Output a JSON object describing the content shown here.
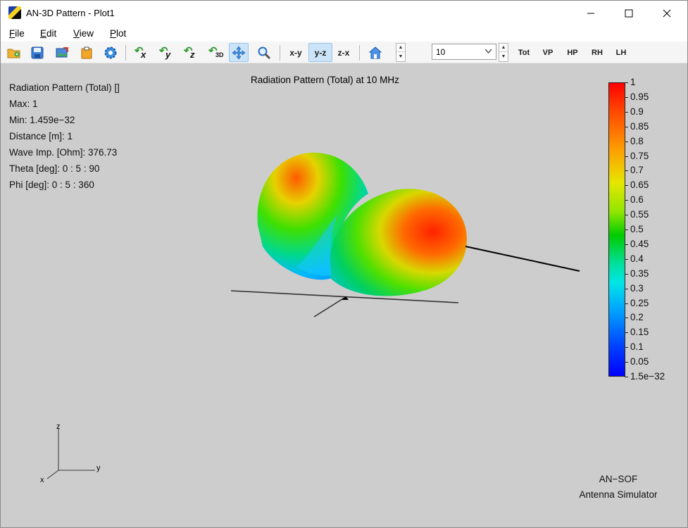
{
  "window": {
    "title": "AN-3D Pattern - Plot1"
  },
  "menu": [
    {
      "label": "File",
      "underline": "F",
      "rest": "ile"
    },
    {
      "label": "Edit",
      "underline": "E",
      "rest": "dit"
    },
    {
      "label": "View",
      "underline": "V",
      "rest": "iew"
    },
    {
      "label": "Plot",
      "underline": "P",
      "rest": "lot"
    }
  ],
  "toolbar": {
    "view_xy": "x-y",
    "view_yz": "y-z",
    "view_zx": "z-x",
    "rot_x": "x",
    "rot_y": "y",
    "rot_z": "z",
    "rot_3d": "3D",
    "combo_value": "10",
    "pol_tot": "Tot",
    "pol_vp": "VP",
    "pol_hp": "HP",
    "pol_rh": "RH",
    "pol_lh": "LH",
    "active_view": "y-z",
    "active_tool": "pan"
  },
  "info": {
    "line1": "Radiation Pattern (Total) []",
    "line2": "Max: 1",
    "line3": "Min: 1.459e−32",
    "line4": "Distance [m]: 1",
    "line5": "Wave Imp. [Ohm]: 376.73",
    "line6": "Theta [deg]: 0 : 5 : 90",
    "line7": "Phi [deg]: 0 : 5 : 360"
  },
  "plot": {
    "title": "Radiation Pattern (Total) at 10 MHz",
    "axis_z": "z",
    "axis_y": "y",
    "axis_x": "x"
  },
  "colorbar": {
    "labels": [
      "1",
      "0.95",
      "0.9",
      "0.85",
      "0.8",
      "0.75",
      "0.7",
      "0.65",
      "0.6",
      "0.55",
      "0.5",
      "0.45",
      "0.4",
      "0.35",
      "0.3",
      "0.25",
      "0.2",
      "0.15",
      "0.1",
      "0.05",
      "1.5e−32"
    ],
    "colors": {
      "max": "#ff0000",
      "mid": "#00cc00",
      "min": "#0000ff"
    }
  },
  "branding": {
    "line1": "AN−SOF",
    "line2": "Antenna Simulator"
  },
  "colors": {
    "plot_background": "#cdcdcd",
    "active_button": "#cce4f7"
  }
}
